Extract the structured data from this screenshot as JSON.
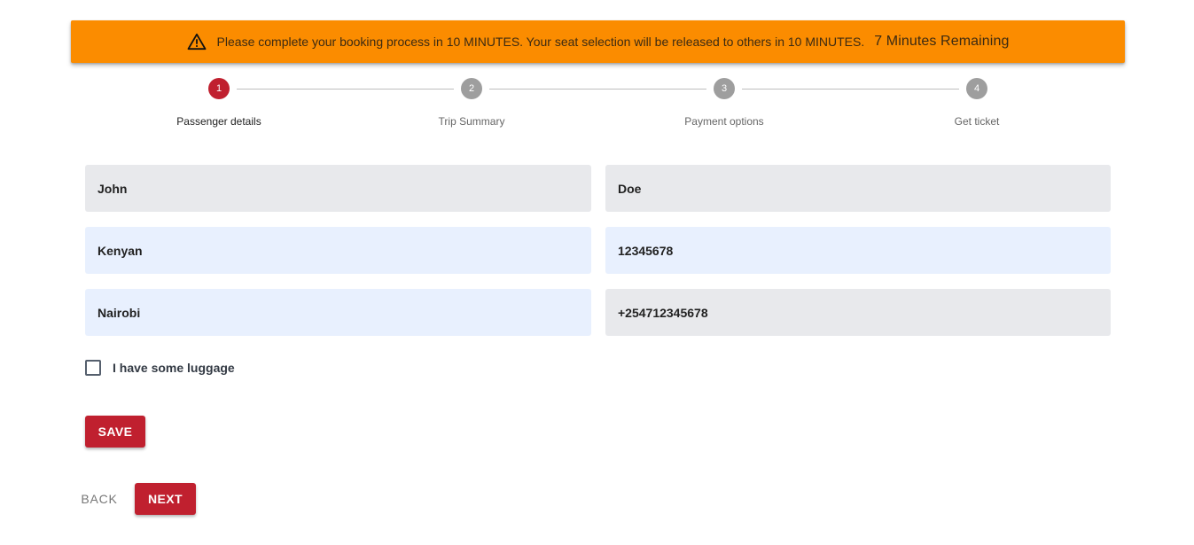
{
  "banner": {
    "icon": "warning-icon",
    "color": "#fb8c00",
    "message": "Please complete your booking process in 10 MINUTES. Your seat selection will be released to others in 10 MINUTES.",
    "remaining": "7 Minutes Remaining"
  },
  "stepper": {
    "active_color": "#c0202f",
    "steps": [
      {
        "number": "1",
        "label": "Passenger details",
        "active": true
      },
      {
        "number": "2",
        "label": "Trip Summary",
        "active": false
      },
      {
        "number": "3",
        "label": "Payment options",
        "active": false
      },
      {
        "number": "4",
        "label": "Get ticket",
        "active": false
      }
    ]
  },
  "form": {
    "first_name": "John",
    "last_name": "Doe",
    "nationality": "Kenyan",
    "id_number": "12345678",
    "city": "Nairobi",
    "phone": "+254712345678",
    "luggage_label": "I have some luggage",
    "luggage_checked": false
  },
  "actions": {
    "save_label": "SAVE",
    "back_label": "BACK",
    "next_label": "NEXT",
    "primary_color": "#c0202f"
  }
}
